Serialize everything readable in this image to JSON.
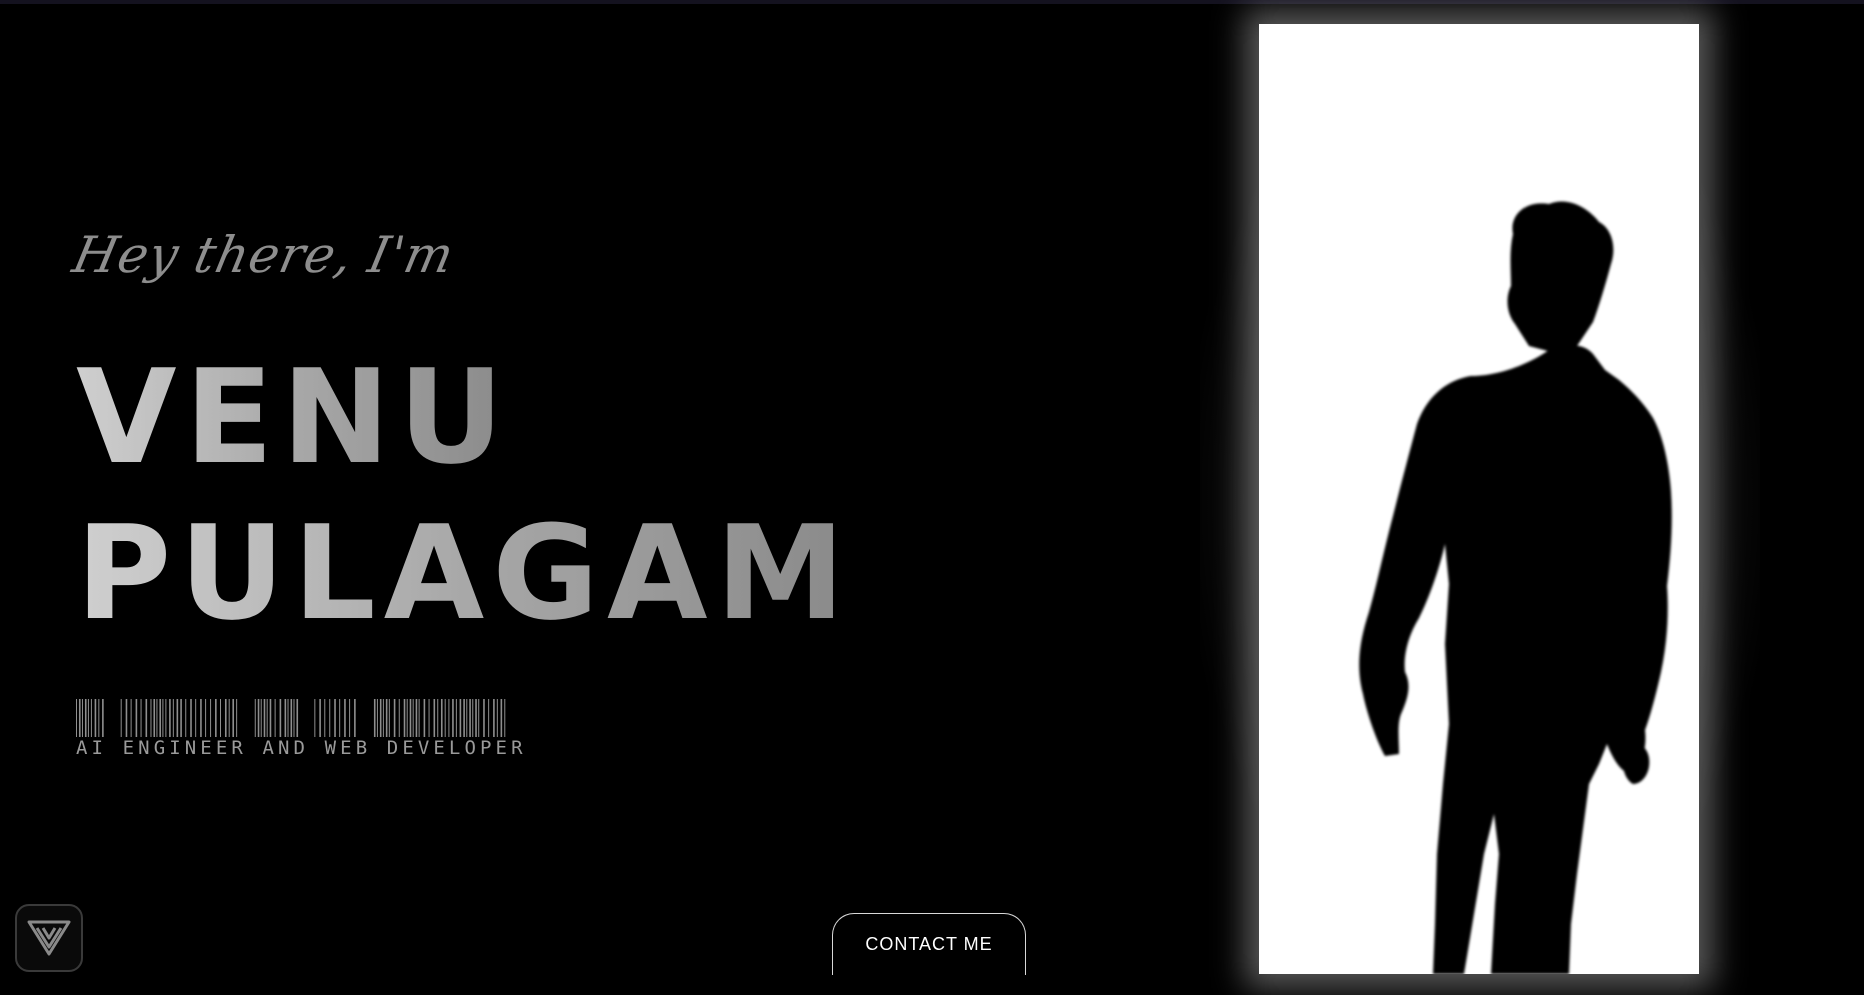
{
  "hero": {
    "greeting": "Hey there, I'm",
    "first_name": "VENU",
    "last_name": "PULAGAM",
    "subtitle": "AI ENGINEER AND WEB DEVELOPER"
  },
  "contact_button": {
    "label": "CONTACT ME"
  },
  "logo": {
    "icon": "chevron-v-logo-icon"
  },
  "photo": {
    "subject": "silhouette-in-doorway"
  },
  "colors": {
    "background": "#000000",
    "text_gray": "#9a9a9a",
    "door": "#ffffff",
    "button_border": "#d8d8d8"
  }
}
